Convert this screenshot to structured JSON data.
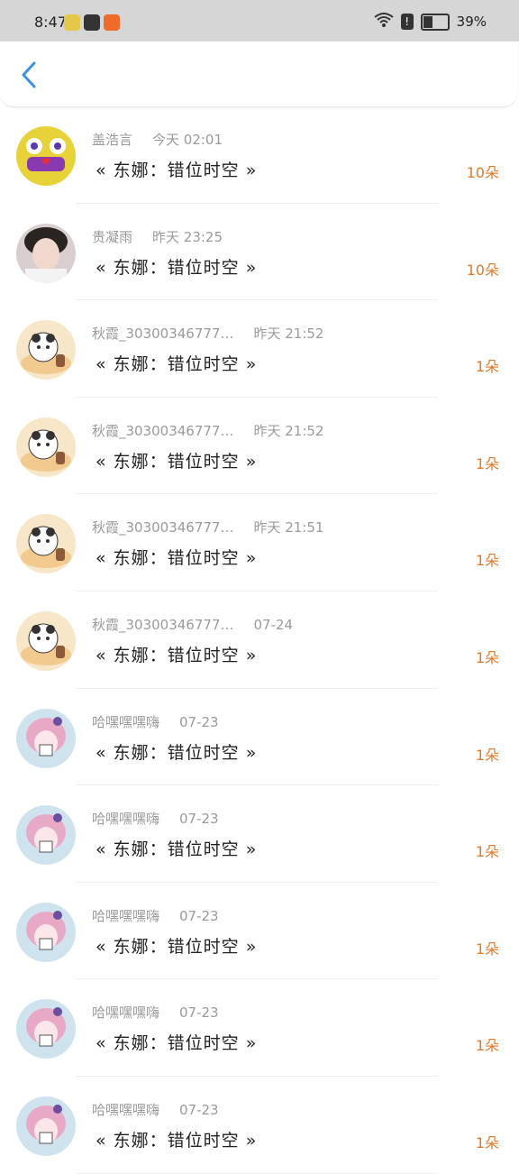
{
  "status_bar": {
    "time": "8:47",
    "battery": "39%"
  },
  "rows": [
    {
      "name": "盖浩言",
      "time": "今天 02:01",
      "title": "« 东娜：错位时空 »",
      "count": "10朵",
      "avatar": "avatar-spongebob"
    },
    {
      "name": "贵凝雨",
      "time": "昨天 23:25",
      "title": "« 东娜：错位时空 »",
      "count": "10朵",
      "avatar": "avatar-photo"
    },
    {
      "name": "秋霞_30300346777…",
      "time": "昨天 21:52",
      "title": "« 东娜：错位时空 »",
      "count": "1朵",
      "avatar": "avatar-panda"
    },
    {
      "name": "秋霞_30300346777…",
      "time": "昨天 21:52",
      "title": "« 东娜：错位时空 »",
      "count": "1朵",
      "avatar": "avatar-panda"
    },
    {
      "name": "秋霞_30300346777…",
      "time": "昨天 21:51",
      "title": "« 东娜：错位时空 »",
      "count": "1朵",
      "avatar": "avatar-panda"
    },
    {
      "name": "秋霞_30300346777…",
      "time": "07-24",
      "title": "« 东娜：错位时空 »",
      "count": "1朵",
      "avatar": "avatar-panda"
    },
    {
      "name": "哈嘿嘿嘿嗨",
      "time": "07-23",
      "title": "« 东娜：错位时空 »",
      "count": "1朵",
      "avatar": "avatar-anime"
    },
    {
      "name": "哈嘿嘿嘿嗨",
      "time": "07-23",
      "title": "« 东娜：错位时空 »",
      "count": "1朵",
      "avatar": "avatar-anime"
    },
    {
      "name": "哈嘿嘿嘿嗨",
      "time": "07-23",
      "title": "« 东娜：错位时空 »",
      "count": "1朵",
      "avatar": "avatar-anime"
    },
    {
      "name": "哈嘿嘿嘿嗨",
      "time": "07-23",
      "title": "« 东娜：错位时空 »",
      "count": "1朵",
      "avatar": "avatar-anime"
    },
    {
      "name": "哈嘿嘿嘿嗨",
      "time": "07-23",
      "title": "« 东娜：错位时空 »",
      "count": "1朵",
      "avatar": "avatar-anime"
    }
  ]
}
